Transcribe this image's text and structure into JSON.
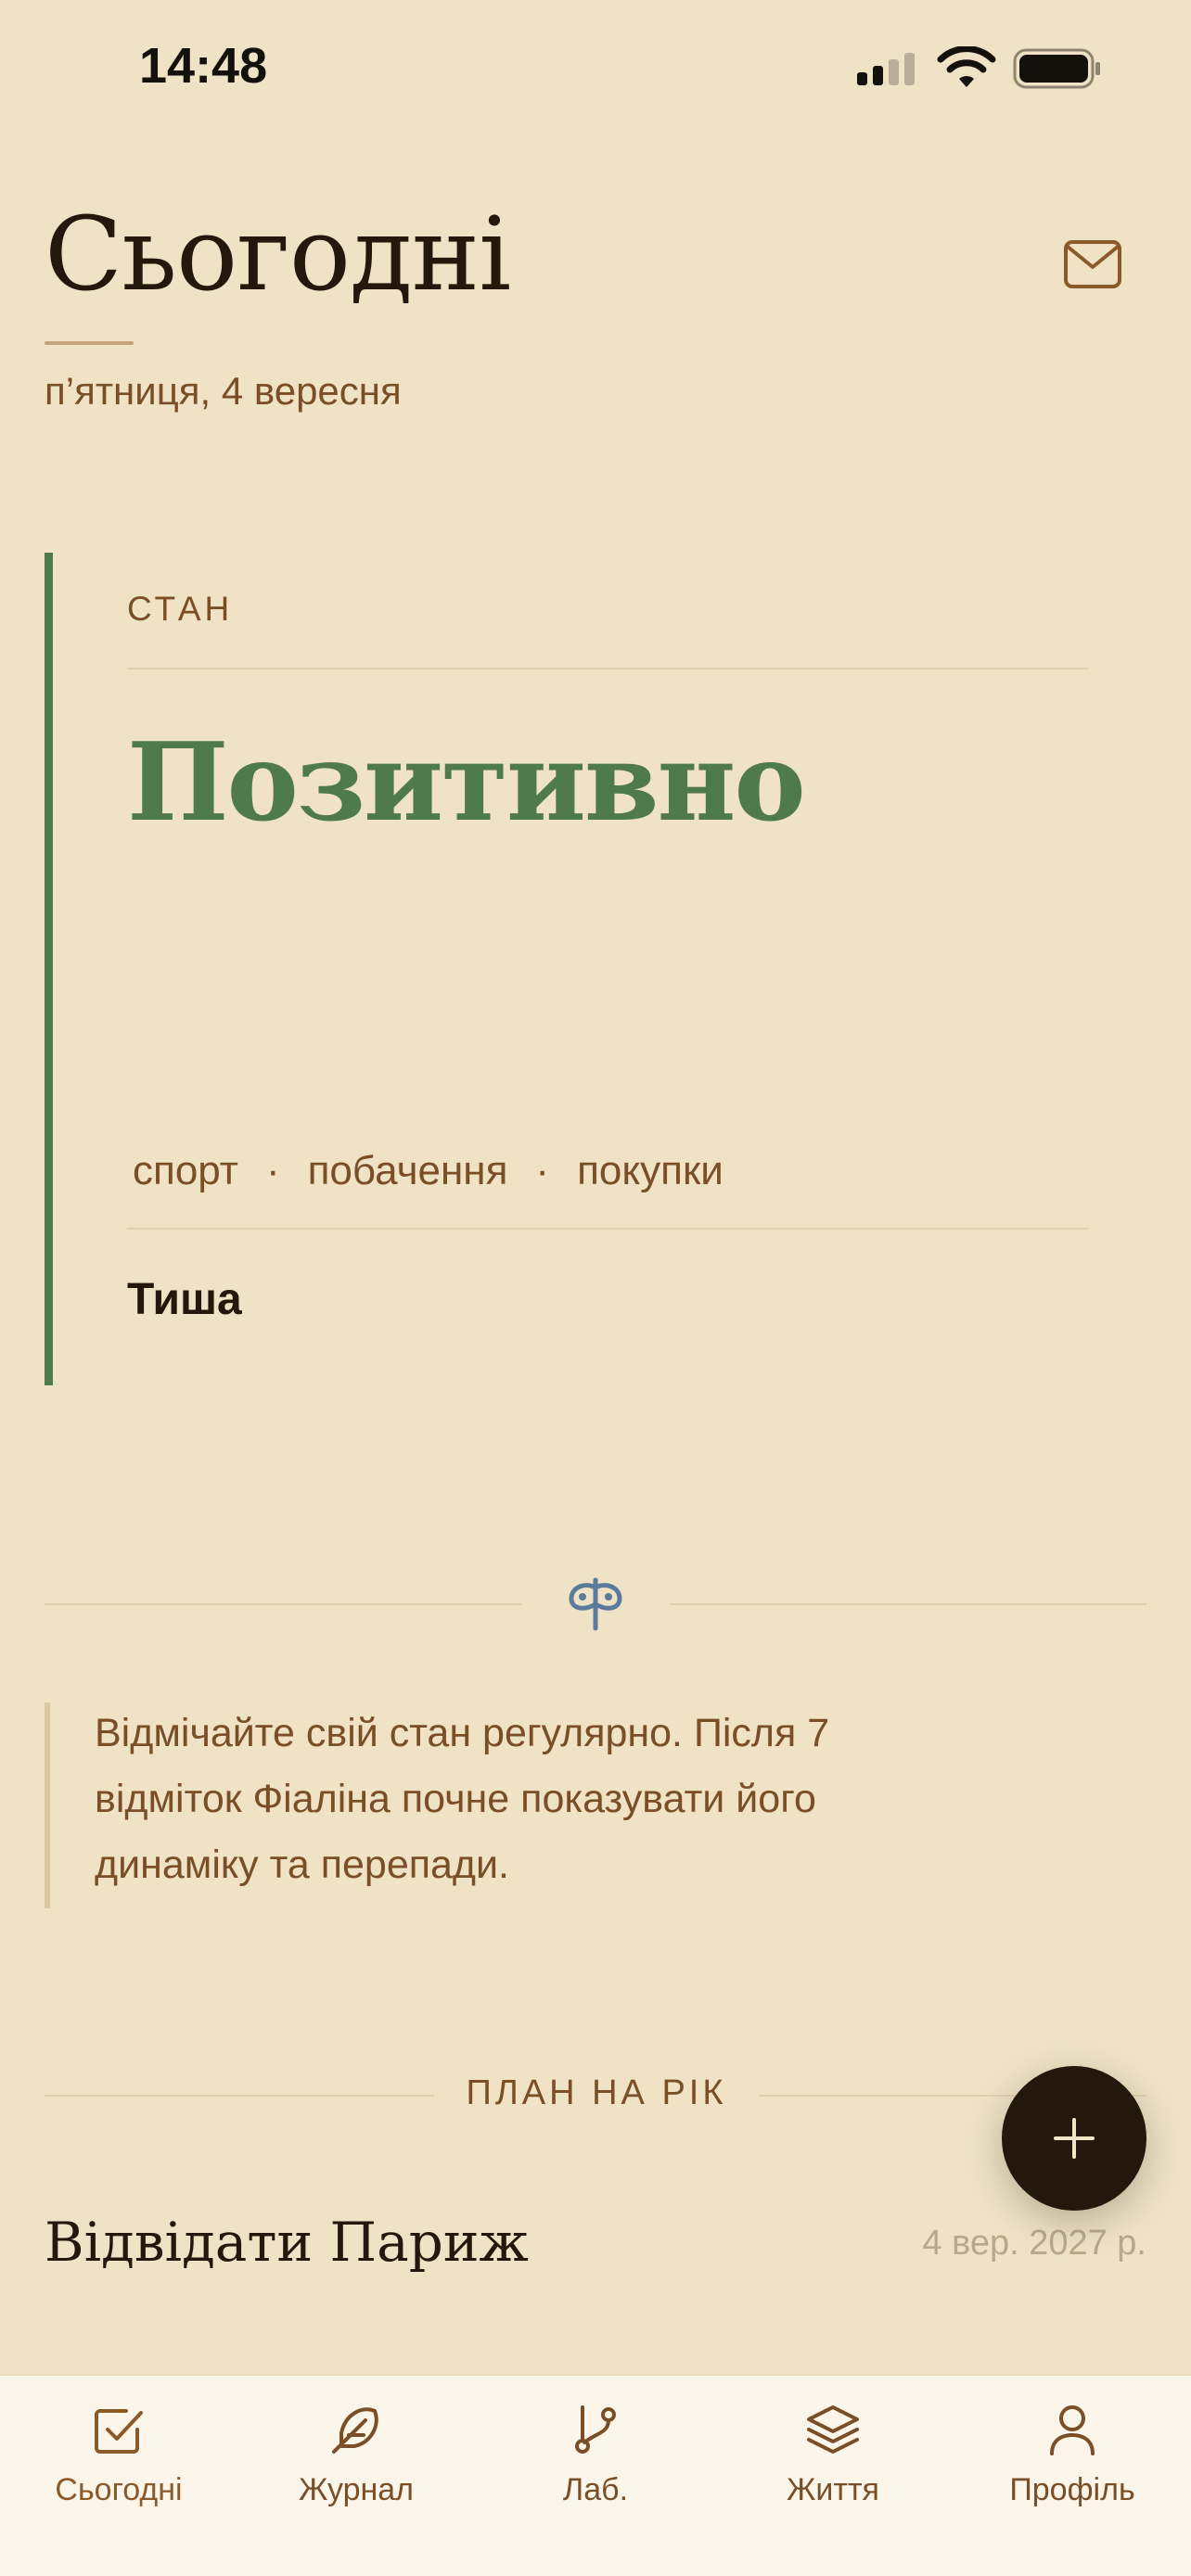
{
  "status_bar": {
    "time": "14:48"
  },
  "header": {
    "title": "Сьогодні",
    "date": "п’ятниця, 4 вересня"
  },
  "mood": {
    "section_label": "СТАН",
    "value": "Позитивно",
    "tags": [
      "спорт",
      "побачення",
      "покупки"
    ],
    "tag_separator": "·",
    "note": "Тиша"
  },
  "tip": {
    "lines": [
      "Відмічайте свій стан регулярно. Після 7",
      "відміток Фіаліна почне показувати його",
      "динаміку та перепади."
    ]
  },
  "year_plan": {
    "label": "ПЛАН НА РІК",
    "items": [
      {
        "title": "Відвідати Париж",
        "date": "4 вер. 2027 р."
      }
    ]
  },
  "fab": {
    "icon": "plus-icon"
  },
  "bottom_nav": {
    "items": [
      {
        "label": "Сьогодні",
        "icon": "check-square-icon",
        "active": true
      },
      {
        "label": "Журнал",
        "icon": "feather-icon",
        "active": false
      },
      {
        "label": "Лаб.",
        "icon": "git-branch-icon",
        "active": false
      },
      {
        "label": "Життя",
        "icon": "layers-icon",
        "active": false
      },
      {
        "label": "Профіль",
        "icon": "user-icon",
        "active": false
      }
    ]
  },
  "colors": {
    "background": "#EFE2C5",
    "accent_brown": "#7A4E27",
    "ink": "#24170c",
    "positive_green": "#4F7A4C",
    "ornament_blue": "#5C7A9C",
    "nav_background": "#FCF6EA"
  }
}
